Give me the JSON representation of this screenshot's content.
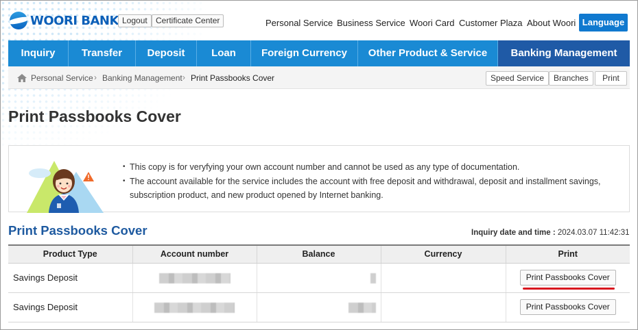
{
  "header": {
    "logo_text": "WOORI BANK",
    "logout_label": "Logout",
    "certificate_label": "Certificate Center",
    "top_menu": [
      "Personal Service",
      "Business Service",
      "Woori Card",
      "Customer Plaza",
      "About Woori"
    ],
    "language_label": "Language"
  },
  "nav": {
    "items": [
      "Inquiry",
      "Transfer",
      "Deposit",
      "Loan",
      "Foreign Currency",
      "Other Product & Service",
      "Banking Management"
    ],
    "active": "Banking Management"
  },
  "breadcrumb": {
    "items": [
      "Personal Service",
      "Banking Management",
      "Print Passbooks Cover"
    ],
    "speed_service": "Speed Service",
    "branches": "Branches",
    "print": "Print"
  },
  "page_title": "Print Passbooks Cover",
  "notice": {
    "lines": [
      "This copy is for veryfying your own account number and cannot be used as any type of documentation.",
      "The account available for the service includes the account with free deposit and withdrawal, deposit and installment savings, subscription product, and new product opened by Internet banking."
    ]
  },
  "section_title": "Print Passbooks Cover",
  "inquiry": {
    "label": "Inquiry date and time :",
    "value": "2024.03.07 11:42:31"
  },
  "table": {
    "headers": [
      "Product Type",
      "Account number",
      "Balance",
      "Currency",
      "Print"
    ],
    "rows": [
      {
        "product_type": "Savings Deposit",
        "currency": "",
        "print_label": "Print Passbooks Cover"
      },
      {
        "product_type": "Savings Deposit",
        "currency": "",
        "print_label": "Print Passbooks Cover"
      }
    ]
  },
  "colors": {
    "nav_bg": "#1a8ad4",
    "nav_active_bg": "#1f5aa6",
    "section_title": "#1e5aa0",
    "highlight_underline": "#d8141e",
    "language_button": "#1079cf"
  }
}
